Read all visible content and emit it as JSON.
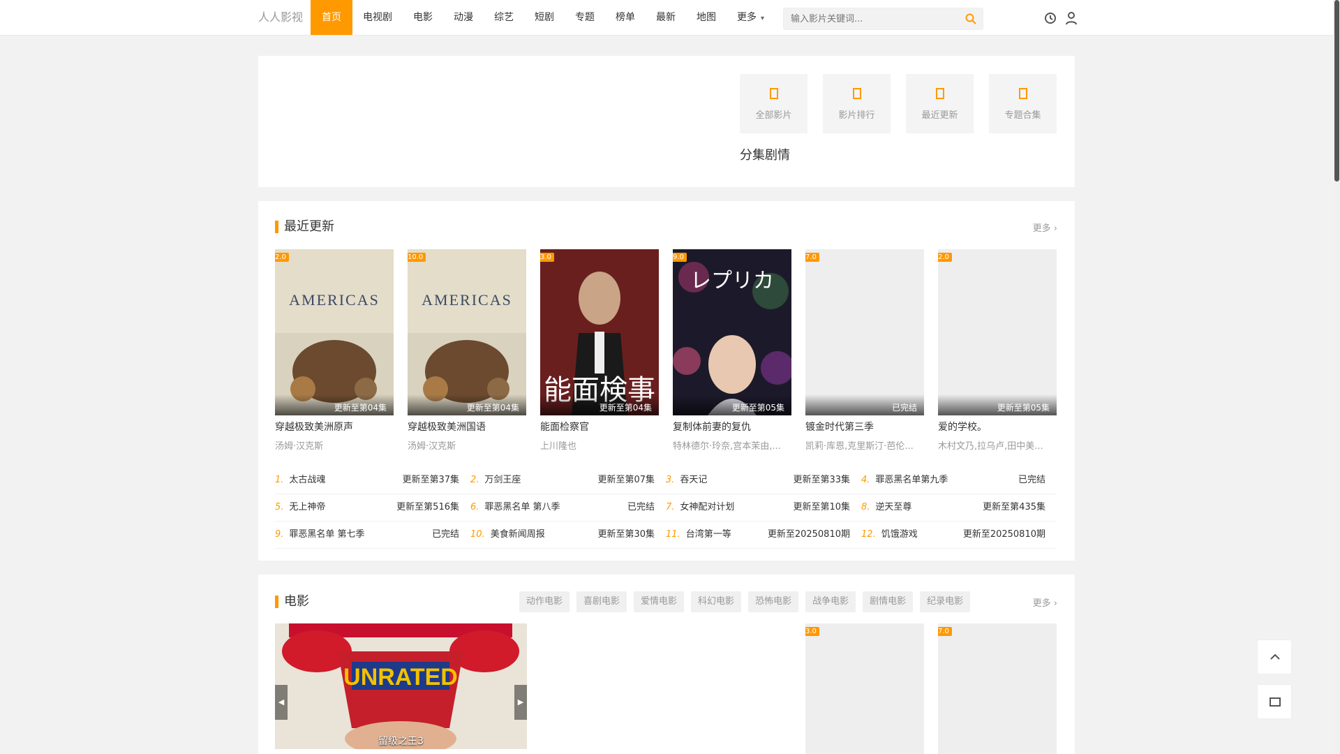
{
  "site": {
    "logo": "人人影视",
    "accent": "#ff9900"
  },
  "nav": {
    "items": [
      "首页",
      "电视剧",
      "电影",
      "动漫",
      "综艺",
      "短剧",
      "专题",
      "榜单",
      "最新",
      "地图"
    ],
    "more": "更多",
    "active": "首页"
  },
  "search": {
    "placeholder": "输入影片关键词..."
  },
  "header_icons": [
    "history-icon",
    "user-icon"
  ],
  "quick": {
    "items": [
      {
        "label": "全部影片",
        "icon": "film-icon"
      },
      {
        "label": "影片排行",
        "icon": "rank-icon"
      },
      {
        "label": "最近更新",
        "icon": "clock-icon"
      },
      {
        "label": "专题合集",
        "icon": "topic-icon"
      }
    ],
    "subtitle": "分集剧情"
  },
  "recent": {
    "title": "最近更新",
    "more": "更多",
    "cards": [
      {
        "score": "2.0",
        "status": "更新至第04集",
        "title": "穿越极致美洲原声",
        "actors": "汤姆·汉克斯",
        "poster": "americas"
      },
      {
        "score": "10.0",
        "status": "更新至第04集",
        "title": "穿越极致美洲国语",
        "actors": "汤姆·汉克斯",
        "poster": "americas"
      },
      {
        "score": "3.0",
        "status": "更新至第04集",
        "title": "能面检察官",
        "actors": "上川隆也",
        "poster": "noumen"
      },
      {
        "score": "9.0",
        "status": "更新至第05集",
        "title": "复制体前妻的复仇",
        "actors": "特林德尔·玲奈,宫本茉由,...",
        "poster": "replica"
      },
      {
        "score": "7.0",
        "status": "已完结",
        "title": "镀金时代第三季",
        "actors": "凯莉·库恩,克里斯汀·芭伦...",
        "poster": "blank"
      },
      {
        "score": "2.0",
        "status": "更新至第05集",
        "title": "爱的学校。",
        "actors": "木村文乃,拉乌卢,田中美...",
        "poster": "blank"
      }
    ],
    "ranking": [
      {
        "n": "1.",
        "title": "太古战魂",
        "status": "更新至第37集"
      },
      {
        "n": "2.",
        "title": "万剑王座",
        "status": "更新至第07集"
      },
      {
        "n": "3.",
        "title": "吞天记",
        "status": "更新至第33集"
      },
      {
        "n": "4.",
        "title": "罪恶黑名单第九季",
        "status": "已完结"
      },
      {
        "n": "5.",
        "title": "无上神帝",
        "status": "更新至第516集"
      },
      {
        "n": "6.",
        "title": "罪恶黑名单 第八季",
        "status": "已完结"
      },
      {
        "n": "7.",
        "title": "女神配对计划",
        "status": "更新至第10集"
      },
      {
        "n": "8.",
        "title": "逆天至尊",
        "status": "更新至第435集"
      },
      {
        "n": "9.",
        "title": "罪恶黑名单 第七季",
        "status": "已完结"
      },
      {
        "n": "10.",
        "title": "美食新闻周报",
        "status": "更新至第30集"
      },
      {
        "n": "11.",
        "title": "台湾第一等",
        "status": "更新至20250810期"
      },
      {
        "n": "12.",
        "title": "饥饿游戏",
        "status": "更新至20250810期"
      }
    ]
  },
  "movies": {
    "title": "电影",
    "more": "更多",
    "tags": [
      "动作电影",
      "喜剧电影",
      "爱情电影",
      "科幻电影",
      "恐怖电影",
      "战争电影",
      "剧情电影",
      "纪录电影"
    ],
    "slide_title": "留级之王3",
    "slide_text": "UNRATED",
    "scores": [
      "3.0",
      "7.0"
    ]
  }
}
